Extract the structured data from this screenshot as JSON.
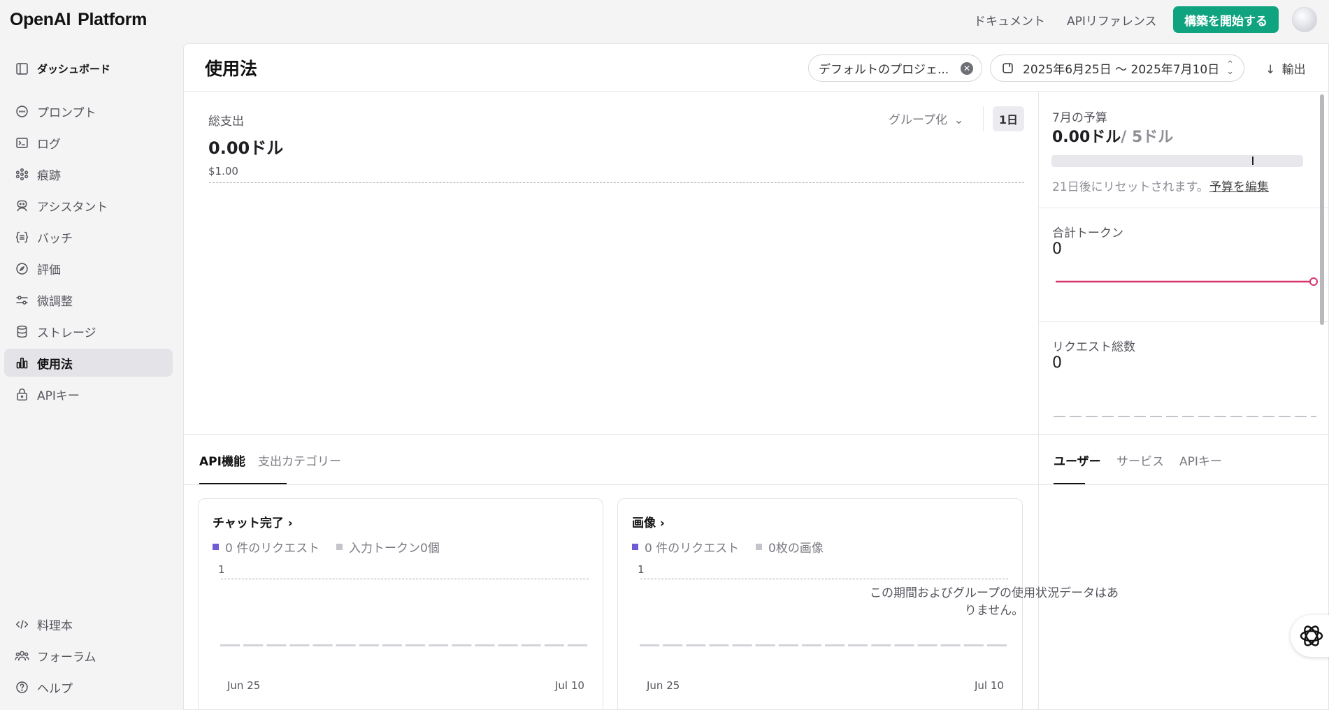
{
  "topbar": {
    "brand_a": "OpenAI",
    "brand_b": "Platform",
    "docs_link": "ドキュメント",
    "api_ref_link": "APIリファレンス",
    "build_button": "構築を開始する"
  },
  "sidebar": {
    "dashboard": "ダッシュボード",
    "items": [
      {
        "label": "プロンプト",
        "icon": "chat-bubble-icon"
      },
      {
        "label": "ログ",
        "icon": "terminal-icon"
      },
      {
        "label": "痕跡",
        "icon": "traces-icon"
      },
      {
        "label": "アシスタント",
        "icon": "assistant-icon"
      },
      {
        "label": "バッチ",
        "icon": "batch-icon"
      },
      {
        "label": "評価",
        "icon": "compass-icon"
      },
      {
        "label": "微調整",
        "icon": "sliders-icon"
      },
      {
        "label": "ストレージ",
        "icon": "database-icon"
      },
      {
        "label": "使用法",
        "icon": "bar-chart-icon",
        "active": true
      },
      {
        "label": "APIキー",
        "icon": "lock-icon"
      }
    ],
    "bottom": [
      {
        "label": "料理本",
        "icon": "code-icon"
      },
      {
        "label": "フォーラム",
        "icon": "people-icon"
      },
      {
        "label": "ヘルプ",
        "icon": "help-icon"
      }
    ]
  },
  "main": {
    "title": "使用法",
    "project_filter": "デフォルトのプロジェ...",
    "date_range": "2025年6月25日 〜 2025年7月10日",
    "export_label": "輸出",
    "total_spend": {
      "label": "総支出",
      "value": "0.00ドル",
      "group_by": "グループ化",
      "interval": "1日",
      "y_top": "$1.00"
    },
    "budget": {
      "label": "7月の予算",
      "spent": "0.00ドル",
      "limit": "/ 5ドル",
      "spent_fraction": 0.0,
      "reset_text": "21日後にリセットされます。",
      "edit_link": "予算を編集"
    },
    "tokens": {
      "label": "合計トークン",
      "value": "0"
    },
    "requests": {
      "label": "リクエスト総数",
      "value": "0"
    },
    "tabs_left": [
      "API機能",
      "支出カテゴリー"
    ],
    "tabs_right": [
      "ユーザー",
      "サービス",
      "APIキー"
    ],
    "right_empty": "この期間およびグループの使用状況データはありません。",
    "cards": [
      {
        "title": "チャット完了",
        "legend": [
          "0 件のリクエスト",
          "入力トークン0個"
        ],
        "y_top": "1",
        "x_start": "Jun 25",
        "x_end": "Jul 10"
      },
      {
        "title": "画像",
        "legend": [
          "0 件のリクエスト",
          "0枚の画像"
        ],
        "y_top": "1",
        "x_start": "Jun 25",
        "x_end": "Jul 10"
      }
    ]
  },
  "colors": {
    "accent_green": "#10a37f",
    "series_primary": "#6e5bd6",
    "series_secondary": "#c4c4cc",
    "tokens_line": "#d6336c"
  },
  "chart_data": [
    {
      "type": "line",
      "title": "総支出",
      "x": [
        "Jun 25",
        "Jul 10"
      ],
      "series": [],
      "ylim": [
        0,
        1.0
      ],
      "ylabel": "",
      "grid": true
    },
    {
      "type": "bar",
      "title": "チャット完了",
      "categories": [
        "Jun 25",
        "",
        "",
        "",
        "",
        "",
        "",
        "",
        "",
        "",
        "",
        "",
        "",
        "",
        "",
        "Jul 10"
      ],
      "series": [
        {
          "name": "0 件のリクエスト",
          "values": [
            0,
            0,
            0,
            0,
            0,
            0,
            0,
            0,
            0,
            0,
            0,
            0,
            0,
            0,
            0,
            0
          ]
        },
        {
          "name": "入力トークン0個",
          "values": [
            0,
            0,
            0,
            0,
            0,
            0,
            0,
            0,
            0,
            0,
            0,
            0,
            0,
            0,
            0,
            0
          ]
        }
      ],
      "ylim": [
        0,
        1
      ]
    },
    {
      "type": "bar",
      "title": "画像",
      "categories": [
        "Jun 25",
        "",
        "",
        "",
        "",
        "",
        "",
        "",
        "",
        "",
        "",
        "",
        "",
        "",
        "",
        "Jul 10"
      ],
      "series": [
        {
          "name": "0 件のリクエスト",
          "values": [
            0,
            0,
            0,
            0,
            0,
            0,
            0,
            0,
            0,
            0,
            0,
            0,
            0,
            0,
            0,
            0
          ]
        },
        {
          "name": "0枚の画像",
          "values": [
            0,
            0,
            0,
            0,
            0,
            0,
            0,
            0,
            0,
            0,
            0,
            0,
            0,
            0,
            0,
            0
          ]
        }
      ],
      "ylim": [
        0,
        1
      ]
    }
  ]
}
